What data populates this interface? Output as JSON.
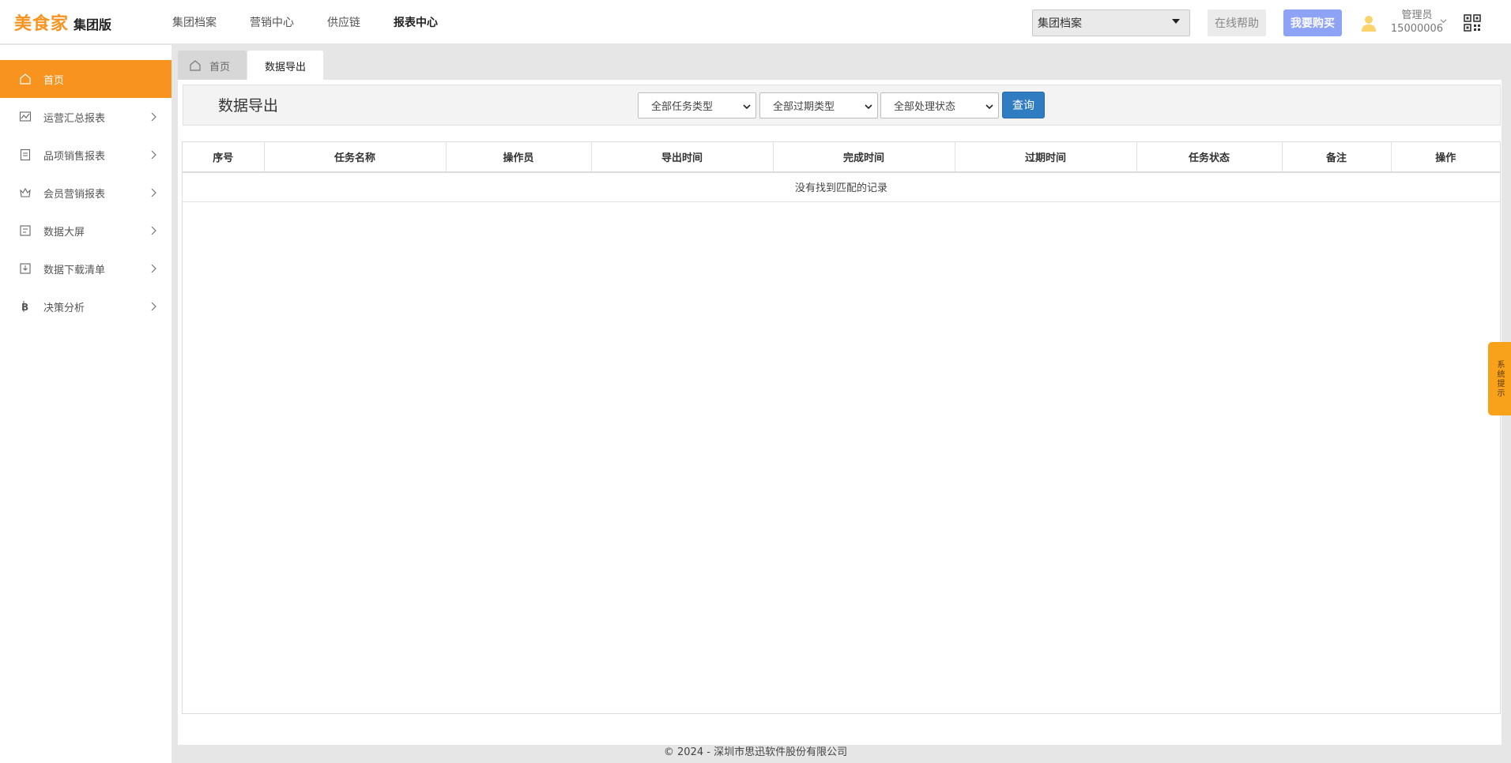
{
  "header": {
    "brand": "美食家",
    "edition": "集团版",
    "nav": [
      "集团档案",
      "营销中心",
      "供应链",
      "报表中心"
    ],
    "active_nav": "报表中心",
    "archive_select": "集团档案",
    "help_label": "在线帮助",
    "buy_label": "我要购买",
    "user_role": "管理员",
    "user_id": "15000006"
  },
  "sidebar": {
    "items": [
      {
        "label": "首页",
        "icon": "home-icon"
      },
      {
        "label": "运营汇总报表",
        "icon": "trend-chart-icon"
      },
      {
        "label": "品项销售报表",
        "icon": "document-icon"
      },
      {
        "label": "会员营销报表",
        "icon": "crown-icon"
      },
      {
        "label": "数据大屏",
        "icon": "screen-icon"
      },
      {
        "label": "数据下载清单",
        "icon": "download-icon"
      },
      {
        "label": "决策分析",
        "icon": "bitcoin-icon"
      }
    ]
  },
  "tabs": {
    "home": "首页",
    "current": "数据导出"
  },
  "main": {
    "title": "数据导出",
    "filters": {
      "task_type": "全部任务类型",
      "expire_type": "全部过期类型",
      "status": "全部处理状态"
    },
    "query_label": "查询",
    "columns": [
      "序号",
      "任务名称",
      "操作员",
      "导出时间",
      "完成时间",
      "过期时间",
      "任务状态",
      "备注",
      "操作"
    ],
    "empty_text": "没有找到匹配的记录"
  },
  "footer": "© 2024 - 深圳市思迅软件股份有限公司",
  "system_tip": "系统提示",
  "colors": {
    "accent": "#f7931e",
    "primary_button": "#2f7cc1",
    "buy_button": "#8ea3f6"
  }
}
